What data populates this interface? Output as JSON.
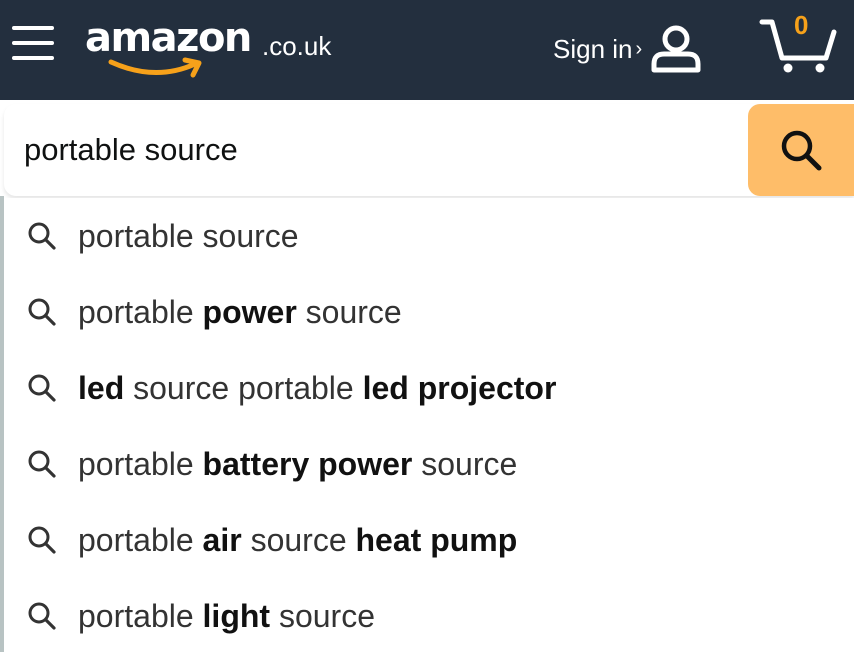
{
  "header": {
    "menu_icon": "hamburger-icon",
    "logo": {
      "word": "amazon",
      "domain": ".co.uk",
      "smile_color": "#f6a11a"
    },
    "sign_in_label": "Sign in",
    "sign_in_chevron": "›",
    "account_icon": "user-icon",
    "cart_icon": "cart-icon",
    "cart_count": "0",
    "background_color": "#232f3e",
    "cart_count_color": "#f6a11a"
  },
  "search": {
    "value": "portable source",
    "button_icon": "search-icon",
    "button_color": "#febd69"
  },
  "suggestions": [
    {
      "parts": [
        {
          "text": "portable source",
          "bold": false
        }
      ]
    },
    {
      "parts": [
        {
          "text": "portable ",
          "bold": false
        },
        {
          "text": "power",
          "bold": true
        },
        {
          "text": " source",
          "bold": false
        }
      ]
    },
    {
      "parts": [
        {
          "text": "led",
          "bold": true
        },
        {
          "text": " source portable ",
          "bold": false
        },
        {
          "text": "led projector",
          "bold": true
        }
      ]
    },
    {
      "parts": [
        {
          "text": "portable ",
          "bold": false
        },
        {
          "text": "battery power",
          "bold": true
        },
        {
          "text": " source",
          "bold": false
        }
      ]
    },
    {
      "parts": [
        {
          "text": "portable ",
          "bold": false
        },
        {
          "text": "air",
          "bold": true
        },
        {
          "text": " source ",
          "bold": false
        },
        {
          "text": "heat pump",
          "bold": true
        }
      ]
    },
    {
      "parts": [
        {
          "text": "portable ",
          "bold": false
        },
        {
          "text": "light",
          "bold": true
        },
        {
          "text": " source",
          "bold": false
        }
      ]
    }
  ]
}
